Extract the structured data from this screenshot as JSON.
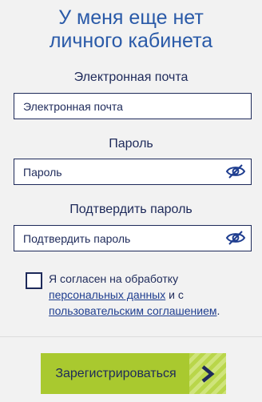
{
  "header": {
    "title_line1": "У меня еще нет",
    "title_line2": "личного кабинета"
  },
  "form": {
    "email": {
      "label": "Электронная почта",
      "placeholder": "Электронная почта"
    },
    "password": {
      "label": "Пароль",
      "placeholder": "Пароль",
      "toggle_icon": "eye-slash-icon"
    },
    "confirm": {
      "label": "Подтвердить пароль",
      "placeholder": "Подтвердить пароль",
      "toggle_icon": "eye-slash-icon"
    }
  },
  "consent": {
    "text_before": "Я согласен на обработку ",
    "link1": "персональных данных",
    "text_middle": " и с ",
    "link2": "пользовательским соглашением",
    "text_after": "."
  },
  "register_button": {
    "label": "Зарегистрироваться",
    "icon": "chevron-right-icon"
  },
  "colors": {
    "title": "#2a5aa8",
    "text": "#1e2a5a",
    "button": "#a9c92f",
    "background": "#f2f2f2"
  }
}
